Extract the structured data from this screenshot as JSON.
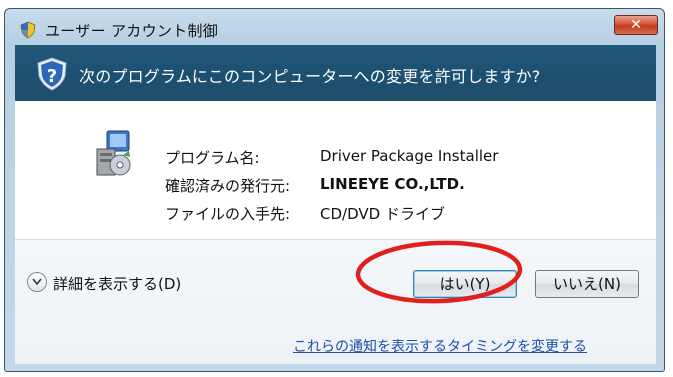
{
  "window": {
    "title": "ユーザー アカウント制御",
    "close_label": "✕"
  },
  "header": {
    "message": "次のプログラムにこのコンピューターへの変更を許可しますか?"
  },
  "program_info": {
    "rows": [
      {
        "label": "プログラム名:",
        "value": "Driver Package Installer"
      },
      {
        "label": "確認済みの発行元:",
        "value": "LINEEYE CO.,LTD."
      },
      {
        "label": "ファイルの入手先:",
        "value": "CD/DVD ドライブ"
      }
    ]
  },
  "footer": {
    "details_label": "詳細を表示する(D)",
    "yes_label": "はい(Y)",
    "no_label": "いいえ(N)",
    "notify_link": "これらの通知を表示するタイミングを変更する"
  },
  "icons": {
    "title_icon": "uac-shield-icon",
    "header_icon": "question-shield-icon",
    "program_icon": "installer-icon",
    "details_icon": "chevron-down-icon"
  },
  "colors": {
    "header_bg": "#1f5577",
    "highlight_circle": "#e0201c",
    "close_button": "#c9472a",
    "link": "#1f4fa8"
  }
}
